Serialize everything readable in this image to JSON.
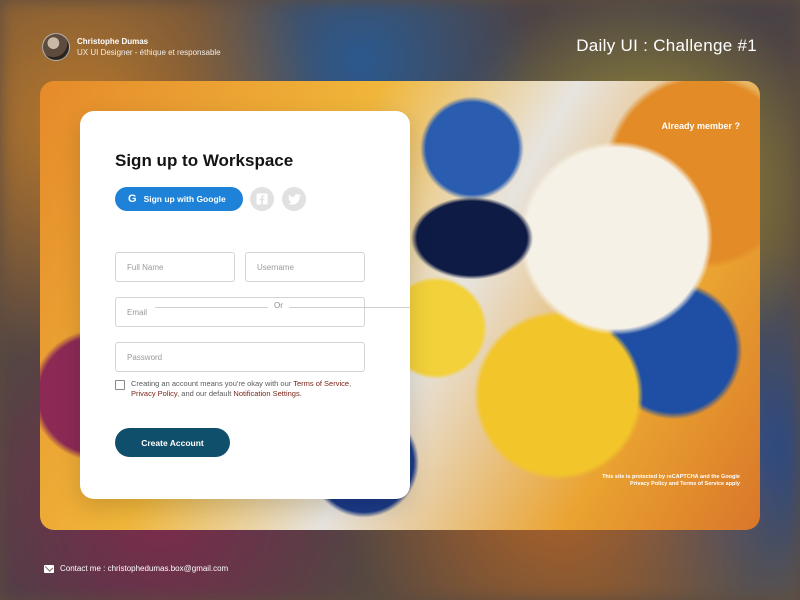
{
  "header": {
    "user_name": "Christophe Dumas",
    "user_role": "UX UI Designer - éthique et responsable",
    "challenge": "Daily UI : Challenge #1"
  },
  "panel": {
    "signin_prompt": "Already member ?",
    "captcha_line1": "This site is protected by reCAPTCHA and the Google",
    "captcha_line2": "Privacy Policy and Terms of Service apply"
  },
  "form": {
    "title": "Sign up to Workspace",
    "google_label": "Sign up with Google",
    "google_mark": "G",
    "or_label": "Or",
    "full_name_placeholder": "Full Name",
    "username_placeholder": "Username",
    "email_placeholder": "Email",
    "password_placeholder": "Password",
    "terms_prefix": "Creating an account means you're okay with our ",
    "terms_link1": "Terms of Service",
    "terms_sep": ", ",
    "terms_link2": "Privacy Policy",
    "terms_mid": ", and our default ",
    "terms_link3": "Notification Settings",
    "terms_end": ".",
    "create_label": "Create Account",
    "terms_checked": false
  },
  "footer": {
    "contact": "Contact me : christophedumas.box@gmail.com"
  },
  "colors": {
    "primary_blue": "#1e82d8",
    "create_button": "#0f4f6b",
    "link": "#7a2418"
  },
  "icons": [
    "avatar",
    "google-icon",
    "facebook-icon",
    "twitter-icon",
    "mail-icon"
  ]
}
